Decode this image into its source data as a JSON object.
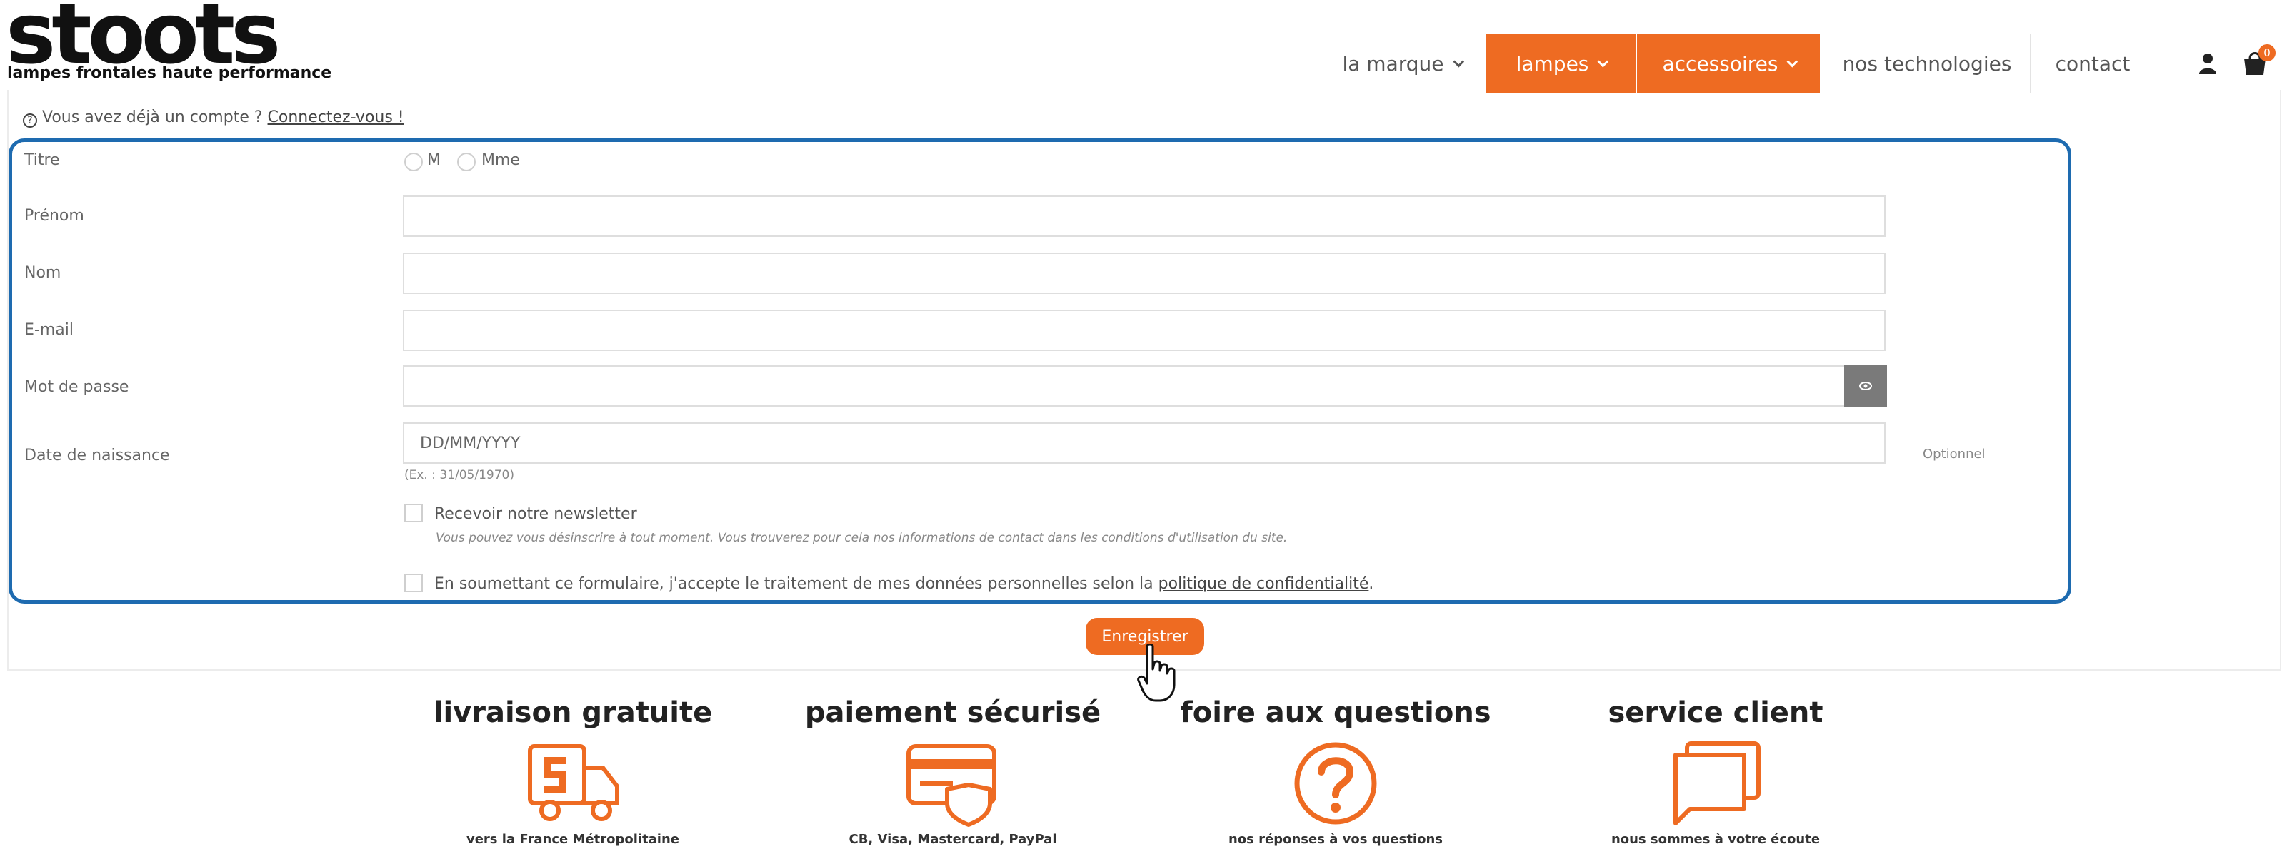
{
  "brand": {
    "logo_text": "stoots",
    "tagline": "lampes frontales haute performance"
  },
  "nav": {
    "items": [
      {
        "label": "la marque",
        "dropdown": true
      },
      {
        "label": "lampes",
        "dropdown": true,
        "active": true
      },
      {
        "label": "accessoires",
        "dropdown": true,
        "active": true
      },
      {
        "label": "nos technologies",
        "dropdown": false
      },
      {
        "label": "contact",
        "dropdown": false
      }
    ],
    "cart_count": "0",
    "accent_color": "#ee6b22"
  },
  "account_prompt": {
    "icon": "question-circle-icon",
    "text": "Vous avez déjà un compte ?",
    "link": "Connectez-vous !"
  },
  "form": {
    "title_label": "Titre",
    "title_options": [
      "M",
      "Mme"
    ],
    "firstname_label": "Prénom",
    "firstname_value": "",
    "lastname_label": "Nom",
    "lastname_value": "",
    "email_label": "E-mail",
    "email_value": "",
    "password_label": "Mot de passe",
    "password_value": "",
    "birthdate_label": "Date de naissance",
    "birthdate_placeholder": "DD/MM/YYYY",
    "birthdate_hint": "(Ex. : 31/05/1970)",
    "birthdate_optional": "Optionnel",
    "newsletter_label": "Recevoir notre newsletter",
    "newsletter_note": "Vous pouvez vous désinscrire à tout moment. Vous trouverez pour cela nos informations de contact dans les conditions d'utilisation du site.",
    "privacy_text": "En soumettant ce formulaire, j'accepte le traitement de mes données personnelles selon la",
    "privacy_link": "politique de confidentialité",
    "privacy_end": ".",
    "submit_label": "Enregistrer",
    "highlight_color": "#1e6bb0"
  },
  "features": [
    {
      "title": "livraison gratuite",
      "subtitle": "vers la France Métropolitaine",
      "icon": "delivery-truck-icon"
    },
    {
      "title": "paiement sécurisé",
      "subtitle": "CB, Visa, Mastercard, PayPal",
      "icon": "credit-card-shield-icon"
    },
    {
      "title": "foire aux questions",
      "subtitle": "nos réponses à vos questions",
      "icon": "question-mark-icon"
    },
    {
      "title": "service client",
      "subtitle": "nous sommes à votre écoute",
      "icon": "chat-bubbles-icon"
    }
  ]
}
